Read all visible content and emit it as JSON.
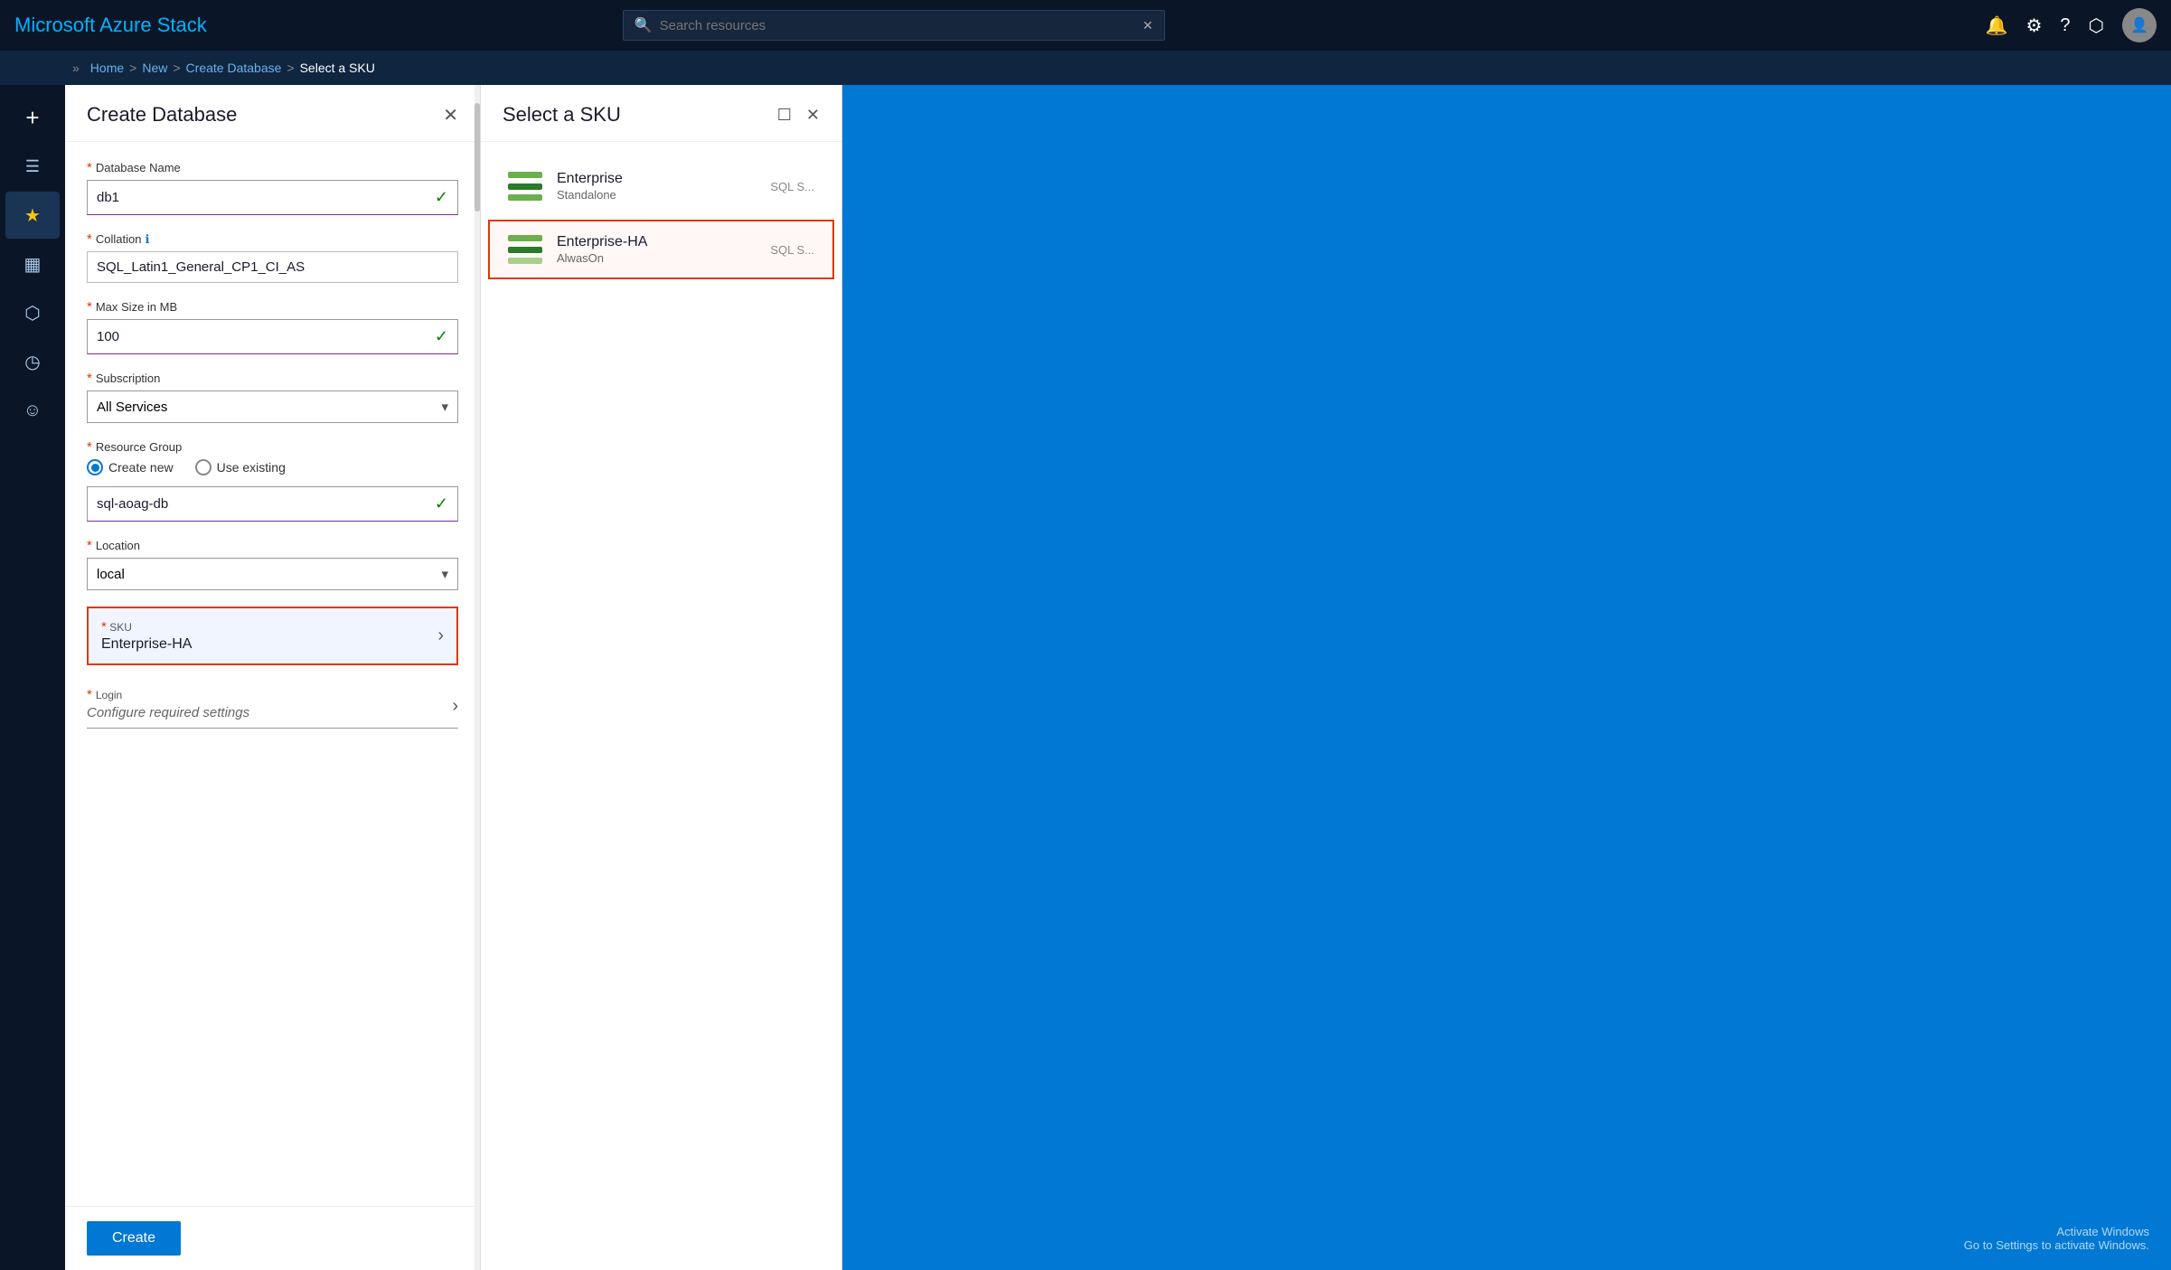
{
  "app": {
    "title": "Microsoft Azure Stack"
  },
  "topbar": {
    "search_placeholder": "Search resources",
    "close_label": "×"
  },
  "breadcrumb": {
    "items": [
      "Home",
      "New",
      "Create Database",
      "Select a SKU"
    ],
    "separators": [
      ">",
      ">",
      ">"
    ]
  },
  "sidebar": {
    "items": [
      {
        "icon": "+",
        "label": ""
      },
      {
        "icon": "☰",
        "label": ""
      },
      {
        "icon": "★",
        "label": ""
      },
      {
        "icon": "▦",
        "label": ""
      },
      {
        "icon": "⬡",
        "label": ""
      },
      {
        "icon": "◷",
        "label": ""
      },
      {
        "icon": "☺",
        "label": ""
      }
    ]
  },
  "create_panel": {
    "title": "Create Database",
    "close_icon": "✕",
    "fields": {
      "database_name": {
        "label": "Database Name",
        "value": "db1",
        "required": true
      },
      "collation": {
        "label": "Collation",
        "info": true,
        "value": "SQL_Latin1_General_CP1_CI_AS",
        "required": true
      },
      "max_size": {
        "label": "Max Size in MB",
        "value": "100",
        "required": true
      },
      "subscription": {
        "label": "Subscription",
        "value": "All Services",
        "required": true
      },
      "resource_group": {
        "label": "Resource Group",
        "required": true,
        "radio_create": "Create new",
        "radio_existing": "Use existing",
        "resource_value": "sql-aoag-db"
      },
      "location": {
        "label": "Location",
        "value": "local",
        "required": true
      },
      "sku": {
        "label": "SKU",
        "value": "Enterprise-HA",
        "required": true
      },
      "login": {
        "label": "Login",
        "placeholder": "Configure required settings",
        "required": true
      }
    },
    "create_button": "Create"
  },
  "sku_panel": {
    "title": "Select a SKU",
    "minimize_icon": "☐",
    "close_icon": "✕",
    "items": [
      {
        "name": "Enterprise",
        "sub": "Standalone",
        "type": "SQL S...",
        "selected": false
      },
      {
        "name": "Enterprise-HA",
        "sub": "AlwasOn",
        "type": "SQL S...",
        "selected": true
      }
    ]
  },
  "activate": {
    "line1": "Activate Windows",
    "line2": "Go to Settings to activate Windows."
  }
}
